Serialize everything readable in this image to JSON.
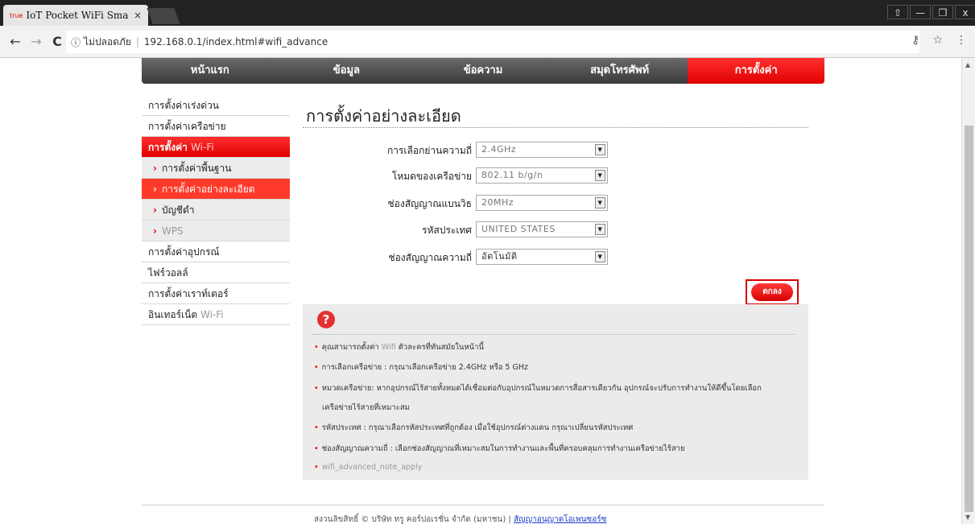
{
  "browser": {
    "tab_favicon": "true",
    "tab_title": "IoT Pocket WiFi Smart I",
    "tab_close": "×",
    "window_controls": [
      "⇧",
      "—",
      "❐",
      "x"
    ],
    "insecure_label": "ไม่ปลอดภัย",
    "url": "192.168.0.1/index.html#wifi_advance"
  },
  "topnav": {
    "items": [
      "หน้าแรก",
      "ข้อมูล",
      "ข้อความ",
      "สมุดโทรศัพท์",
      "การตั้งค่า"
    ],
    "active_index": 4
  },
  "sidebar": {
    "quick_setup": "การตั้งค่าเร่งด่วน",
    "network_setup": "การตั้งค่าเครือข่าย",
    "wifi_setup_th": "การตั้งค่า",
    "wifi_setup_en": "Wi-Fi",
    "sub_basic": "การตั้งค่าพื้นฐาน",
    "sub_advanced": "การตั้งค่าอย่างละเอียด",
    "sub_account": "บัญชีดำ",
    "sub_wps": "WPS",
    "device_setup": "การตั้งค่าอุปกรณ์",
    "firewall": "ไฟร์วอลล์",
    "router_setup": "การตั้งค่าเราท์เตอร์",
    "internet_th": "อินเทอร์เน็ต",
    "internet_en": "Wi-Fi"
  },
  "main": {
    "title": "การตั้งค่าอย่างละเอียด",
    "fields": {
      "band_label": "การเลือกย่านความถี่",
      "band_value": "2.4GHz",
      "mode_label": "โหมดของเครือข่าย",
      "mode_value": "802.11 b/g/n",
      "bandwidth_label": "ช่องสัญญาณแบนวิธ",
      "bandwidth_value": "20MHz",
      "country_label": "รหัสประเทศ",
      "country_value": "UNITED STATES",
      "channel_label": "ช่องสัญญาณความถี่",
      "channel_value": "อัตโนมัติ"
    },
    "ok_label": "ตกลง"
  },
  "help": {
    "icon": "?",
    "line1_a": "คุณสามารถตั้งค่า",
    "line1_en": "Wifi",
    "line1_b": "ตัวละครที่ทันสมัยในหน้านี้",
    "line2": "การเลือกเครือข่าย : กรุณาเลือกเครือข่าย 2.4GHz หรือ 5 GHz",
    "line3a": "หมวดเครือข่าย: หากอุปกรณ์ไร้สายทั้งหมดได้เชื่อมต่อกับอุปกรณ์ในหมวดการสื่อสารเดียวกัน อุปกรณ์จะปรับการทำงานให้ดีขึ้นโดยเลือก",
    "line3b": "เครือข่ายไร้สายที่เหมาะสม",
    "line4": "รหัสประเทศ :  กรุณาเลือกรหัสประเทศที่ถูกต้อง เมื่อใช้อุปกรณ์ต่างแดน กรุณาเปลี่ยนรหัสประเทศ",
    "line5": "ช่องสัญญาณความถี่ : เลือกช่องสัญญาณที่เหมาะสมในการทำงานและพื้นที่ครอบคลุมการทำงานเครือข่ายไร้สาย",
    "line6": "wifi_advanced_note_apply"
  },
  "footer": {
    "copyright": "สงวนลิขสิทธิ์ © บริษัท ทรู คอร์ปอเรชั่น จำกัด (มหาชน)  |",
    "license_link": "สัญญาอนุญาตโอเพนซอร์ซ"
  }
}
